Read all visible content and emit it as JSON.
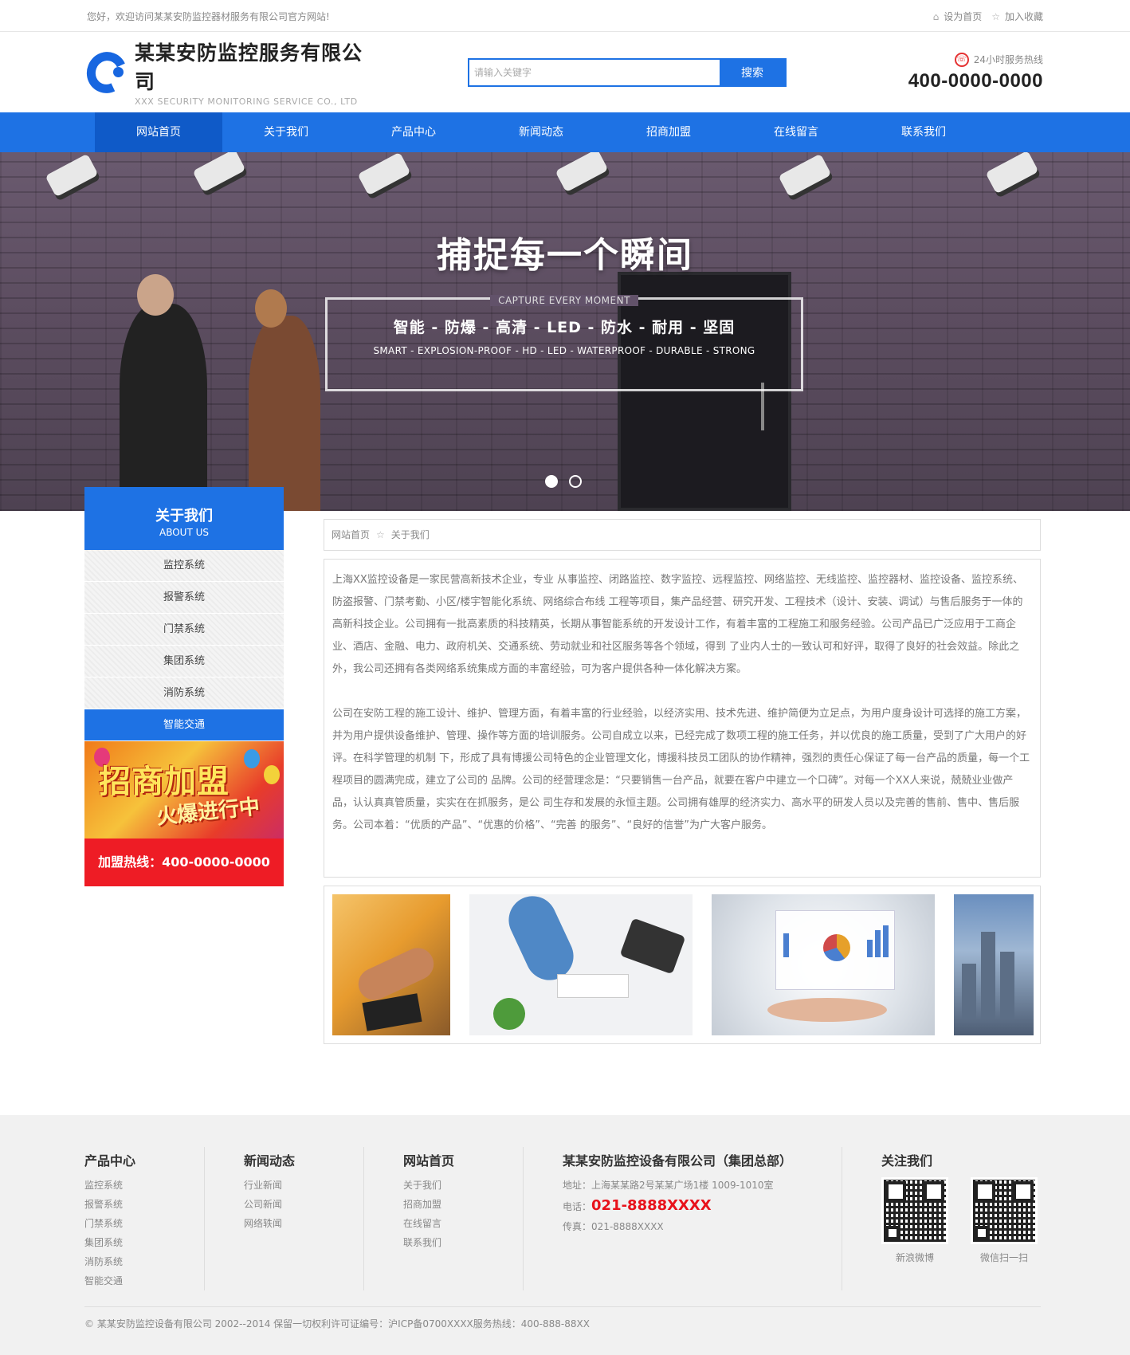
{
  "topbar": {
    "welcome": "您好，欢迎访问某某安防监控器材服务有限公司官方网站!",
    "set_home": "设为首页",
    "add_fav": "加入收藏"
  },
  "header": {
    "logo_cn": "某某安防监控服务有限公司",
    "logo_en": "XXX SECURITY MONITORING SERVICE CO., LTD",
    "search_placeholder": "请输入关键字",
    "search_button": "搜索",
    "hotline_label": "24小时服务热线",
    "hotline_number": "400-0000-0000"
  },
  "nav": {
    "items": [
      {
        "label": "网站首页"
      },
      {
        "label": "关于我们"
      },
      {
        "label": "产品中心"
      },
      {
        "label": "新闻动态"
      },
      {
        "label": "招商加盟"
      },
      {
        "label": "在线留言"
      },
      {
        "label": "联系我们"
      }
    ],
    "active_index": 0
  },
  "banner": {
    "slogan": "捕捉每一个瞬间",
    "subtitle_en": "CAPTURE EVERY MOMENT",
    "features": "智能 - 防爆 - 高清 - LED - 防水 - 耐用 - 坚固",
    "features_en": "SMART - EXPLOSION-PROOF - HD - LED - WATERPROOF - DURABLE - STRONG",
    "slide_count": 2,
    "current_slide": 1
  },
  "sidebar": {
    "title": "关于我们",
    "title_en": "ABOUT US",
    "items": [
      {
        "label": "监控系统"
      },
      {
        "label": "报警系统"
      },
      {
        "label": "门禁系统"
      },
      {
        "label": "集团系统"
      },
      {
        "label": "消防系统"
      },
      {
        "label": "智能交通"
      }
    ],
    "active_index": 5,
    "promo_title": "招商加盟",
    "promo_sub": "火爆进行中",
    "promo_tel": "加盟热线：400-0000-0000"
  },
  "breadcrumb": {
    "home": "网站首页",
    "current": "关于我们"
  },
  "article": {
    "p1": "上海XX监控设备是一家民营高新技术企业，专业 从事监控、闭路监控、数字监控、远程监控、网络监控、无线监控、监控器材、监控设备、监控系统、防盗报警、门禁考勤、小区/楼宇智能化系统、网络综合布线 工程等项目，集产品经营、研究开发、工程技术（设计、安装、调试）与售后服务于一体的高新科技企业。公司拥有一批高素质的科技精英，长期从事智能系统的开发设计工作，有着丰富的工程施工和服务经验。公司产品已广泛应用于工商企业、酒店、金融、电力、政府机关、交通系统、劳动就业和社区服务等各个领域，得到 了业内人士的一致认可和好评，取得了良好的社会效益。除此之外，我公司还拥有各类网络系统集成方面的丰富经验，可为客户提供各种一体化解决方案。",
    "p2": "公司在安防工程的施工设计、维护、管理方面，有着丰富的行业经验，以经济实用、技术先进、维护简便为立足点，为用户度身设计可选择的施工方案，并为用户提供设备维护、管理、操作等方面的培训服务。公司自成立以来，已经完成了数项工程的施工任务，并以优良的施工质量，受到了广大用户的好评。在科学管理的机制 下，形成了具有博援公司特色的企业管理文化，博援科技员工团队的协作精神，强烈的责任心保证了每一台产品的质量，每一个工程项目的圆满完成，建立了公司的 品牌。公司的经营理念是：“只要销售一台产品，就要在客户中建立一个口碑”。对每一个XX人来说，兢兢业业做产品，认认真真管质量，实实在在抓服务，是公 司生存和发展的永恒主题。公司拥有雄厚的经济实力、高水平的研发人员以及完善的售前、售中、售后服务。公司本着：“优质的产品”、“优惠的价格”、“完善 的服务”、“良好的信誉”为广大客户服务。"
  },
  "footer": {
    "col1": {
      "title": "产品中心",
      "links": [
        "监控系统",
        "报警系统",
        "门禁系统",
        "集团系统",
        "消防系统",
        "智能交通"
      ]
    },
    "col2": {
      "title": "新闻动态",
      "links": [
        "行业新闻",
        "公司新闻",
        "网络轶闻"
      ]
    },
    "col3": {
      "title": "网站首页",
      "links": [
        "关于我们",
        "招商加盟",
        "在线留言",
        "联系我们"
      ]
    },
    "contact": {
      "title": "某某安防监控设备有限公司（集团总部）",
      "address": "地址：上海某某路2号某某广场1楼 1009-1010室",
      "tel_label": "电话：",
      "tel": "021-8888XXXX",
      "fax": "传真：021-8888XXXX"
    },
    "follow": {
      "title": "关注我们",
      "qr1_label": "新浪微博",
      "qr2_label": "微信扫一扫"
    },
    "copyright": "© 某某安防监控设备有限公司 2002--2014 保留一切权利许可证编号：沪ICP备0700XXXX服务热线：400-888-88XX"
  }
}
